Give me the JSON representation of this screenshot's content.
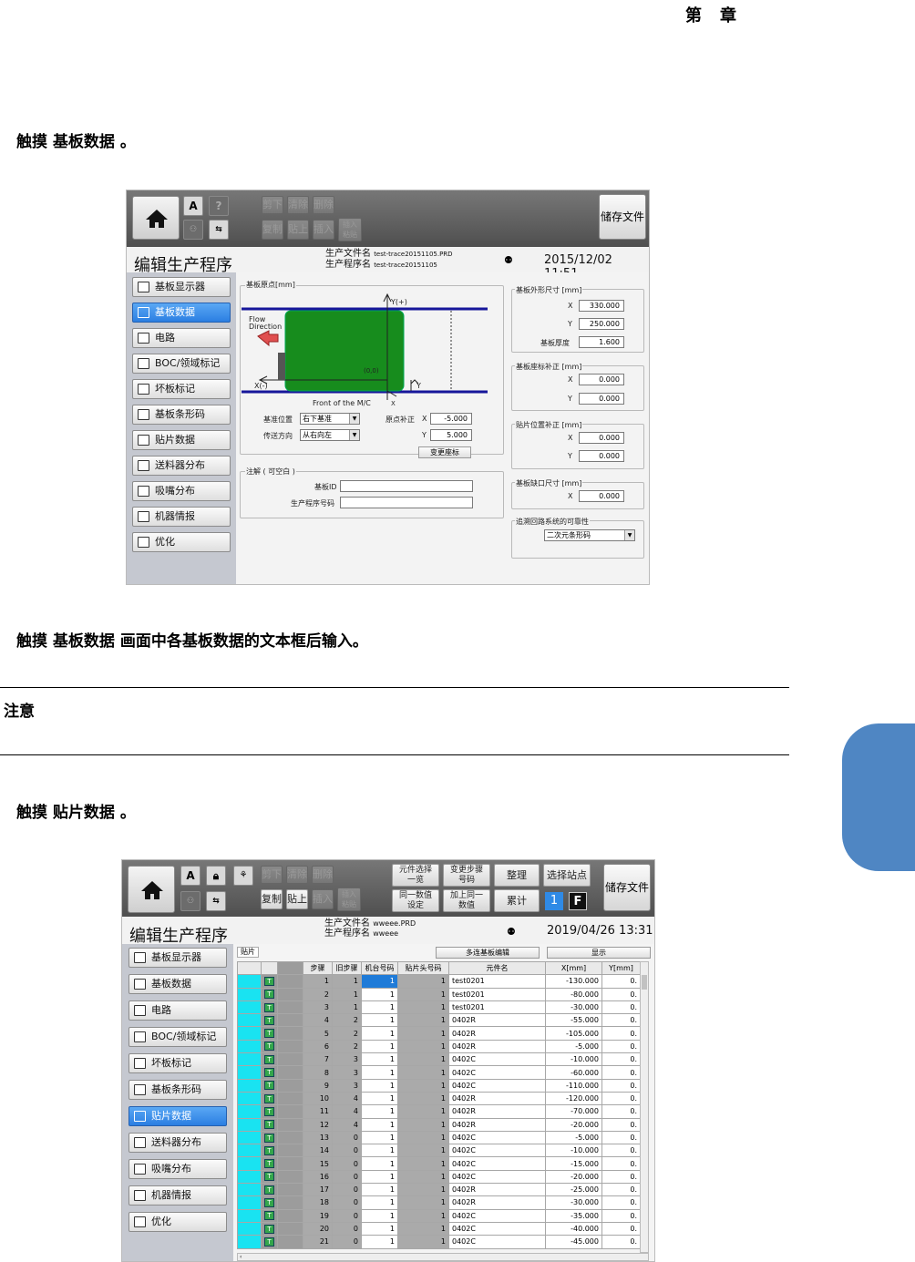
{
  "chapter": {
    "a": "第",
    "b": "章"
  },
  "steps": [
    "触摸 基板数据 。",
    "触摸 基板数据 画面中各基板数据的文本框后输入。",
    "触摸 贴片数据 。"
  ],
  "note": "注意",
  "s1": {
    "toolbar": {
      "cut": "剪下",
      "clear": "清除",
      "del": "删除",
      "copy": "复制",
      "paste": "贴上",
      "insert": "插入",
      "ins_paste": "插入\n粘贴",
      "save": "储存文件"
    },
    "title": "编辑生产程序",
    "file_label": "生产文件名",
    "file_value": "test-trace20151105.PRD",
    "prog_label": "生产程序名",
    "prog_value": "test-trace20151105",
    "datetime": "2015/12/02 11:51",
    "nav": [
      "基板显示器",
      "基板数据",
      "电路",
      "BOC/领域标记",
      "坏板标记",
      "基板条形码",
      "贴片数据",
      "送料器分布",
      "吸嘴分布",
      "机器情报",
      "优化"
    ],
    "origin": {
      "title": "基板原点[mm]",
      "yplus": "Y(+)",
      "xminus": "X(-)",
      "flow": "Flow Direction",
      "front": "Front of the M/C",
      "zero": "(0,0)",
      "y": "Y",
      "x": "X",
      "base_pos_label": "基准位置",
      "base_pos": "右下基准",
      "transfer_label": "传送方向",
      "transfer": "从右向左",
      "orig_corr_label": "原点补正",
      "x_val": "-5.000",
      "y_val": "5.000",
      "change_btn": "变更座标"
    },
    "comment": {
      "title": "注解 ( 可空白 )",
      "board_id": "基板ID",
      "prog_no": "生产程序号码"
    },
    "outer": {
      "title": "基板外形尺寸 [mm]",
      "x": "330.000",
      "y": "250.000",
      "thk_label": "基板厚度",
      "thk": "1.600"
    },
    "coordcorr": {
      "title": "基板座标补正 [mm]",
      "x": "0.000",
      "y": "0.000"
    },
    "poscorr": {
      "title": "贴片位置补正 [mm]",
      "x": "0.000",
      "y": "0.000"
    },
    "notch": {
      "title": "基板缺口尺寸 [mm]",
      "x": "0.000"
    },
    "trace": {
      "title": "追溯回路系统的可靠性",
      "value": "二次元条形码"
    }
  },
  "s2": {
    "toolbar": {
      "cut": "剪下",
      "clear": "清除",
      "del": "删除",
      "copy": "复制",
      "paste": "贴上",
      "insert": "插入",
      "ins_paste": "插入\n粘贴",
      "comp_list": "元件选择\n一览",
      "chg_step": "变更步骤\n号码",
      "arrange": "整理",
      "select_station": "选择站点",
      "same_value": "同一数值\n设定",
      "add_same": "加上同一\n数值",
      "accum": "累计",
      "station_no": "1",
      "station_f": "F",
      "save": "储存文件"
    },
    "title": "编辑生产程序",
    "file_label": "生产文件名",
    "file_value": "wweee.PRD",
    "prog_label": "生产程序名",
    "prog_value": "wweee",
    "datetime": "2019/04/26 13:31",
    "nav": [
      "基板显示器",
      "基板数据",
      "电路",
      "BOC/领域标记",
      "坏板标记",
      "基板条形码",
      "贴片数据",
      "送料器分布",
      "吸嘴分布",
      "机器情报",
      "优化"
    ],
    "tab": "贴片",
    "multi_edit": "多连基板编辑",
    "display": "显示",
    "cols": [
      "步骤",
      "旧步骤",
      "机台号码",
      "贴片头号码",
      "元件名",
      "X[mm]",
      "Y[mm]"
    ],
    "rows": [
      [
        "1",
        "1",
        "1",
        "1",
        "test0201",
        "-130.000",
        "0."
      ],
      [
        "2",
        "1",
        "1",
        "1",
        "test0201",
        "-80.000",
        "0."
      ],
      [
        "3",
        "1",
        "1",
        "1",
        "test0201",
        "-30.000",
        "0."
      ],
      [
        "4",
        "2",
        "1",
        "1",
        "0402R",
        "-55.000",
        "0."
      ],
      [
        "5",
        "2",
        "1",
        "1",
        "0402R",
        "-105.000",
        "0."
      ],
      [
        "6",
        "2",
        "1",
        "1",
        "0402R",
        "-5.000",
        "0."
      ],
      [
        "7",
        "3",
        "1",
        "1",
        "0402C",
        "-10.000",
        "0."
      ],
      [
        "8",
        "3",
        "1",
        "1",
        "0402C",
        "-60.000",
        "0."
      ],
      [
        "9",
        "3",
        "1",
        "1",
        "0402C",
        "-110.000",
        "0."
      ],
      [
        "10",
        "4",
        "1",
        "1",
        "0402R",
        "-120.000",
        "0."
      ],
      [
        "11",
        "4",
        "1",
        "1",
        "0402R",
        "-70.000",
        "0."
      ],
      [
        "12",
        "4",
        "1",
        "1",
        "0402R",
        "-20.000",
        "0."
      ],
      [
        "13",
        "0",
        "1",
        "1",
        "0402C",
        "-5.000",
        "0."
      ],
      [
        "14",
        "0",
        "1",
        "1",
        "0402C",
        "-10.000",
        "0."
      ],
      [
        "15",
        "0",
        "1",
        "1",
        "0402C",
        "-15.000",
        "0."
      ],
      [
        "16",
        "0",
        "1",
        "1",
        "0402C",
        "-20.000",
        "0."
      ],
      [
        "17",
        "0",
        "1",
        "1",
        "0402R",
        "-25.000",
        "0."
      ],
      [
        "18",
        "0",
        "1",
        "1",
        "0402R",
        "-30.000",
        "0."
      ],
      [
        "19",
        "0",
        "1",
        "1",
        "0402C",
        "-35.000",
        "0."
      ],
      [
        "20",
        "0",
        "1",
        "1",
        "0402C",
        "-40.000",
        "0."
      ],
      [
        "21",
        "0",
        "1",
        "1",
        "0402C",
        "-45.000",
        "0."
      ]
    ],
    "skip_mark": "T"
  }
}
